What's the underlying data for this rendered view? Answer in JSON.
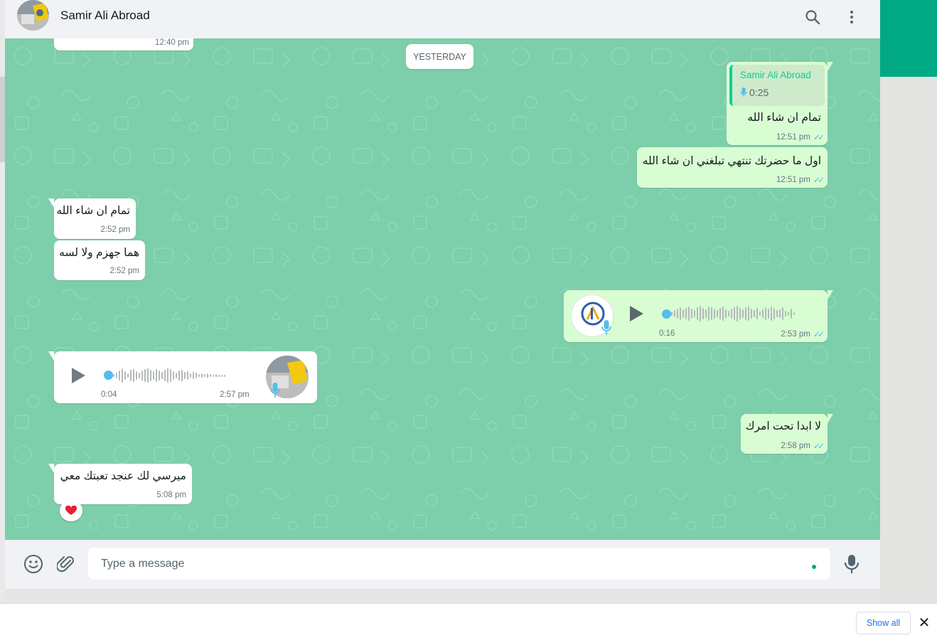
{
  "header": {
    "contact_name": "Samir Ali Abroad"
  },
  "top_partial": {
    "time": "12:40 pm"
  },
  "date_divider": "YESTERDAY",
  "messages": [
    {
      "dir": "out",
      "quote_name": "Samir Ali Abroad",
      "quote_duration": "0:25",
      "text": "تمام ان شاء الله",
      "time": "12:51 pm"
    },
    {
      "dir": "out",
      "text": "اول ما حضرتك تنتهي تبلغني ان شاء الله",
      "time": "12:51 pm"
    },
    {
      "dir": "in",
      "text": "تمام ان شاء الله",
      "time": "2:52 pm"
    },
    {
      "dir": "in",
      "text": "هما جهزم ولا لسه",
      "time": "2:52 pm"
    },
    {
      "dir": "out",
      "voice": true,
      "duration": "0:16",
      "time": "2:53 pm",
      "avatar_text": "RADIANCE GROUP"
    },
    {
      "dir": "in",
      "voice": true,
      "duration": "0:04",
      "time": "2:57 pm"
    },
    {
      "dir": "out",
      "text": "لا ابدا تحت امرك",
      "time": "2:58 pm"
    },
    {
      "dir": "in",
      "text": "ميرسي لك عنجد تعبتك معي",
      "time": "5:08 pm",
      "reaction": "heart"
    }
  ],
  "composer": {
    "placeholder": "Type a message"
  },
  "downloads_bar": {
    "show_all": "Show all",
    "close": "✕"
  },
  "colors": {
    "accent": "#00a884",
    "chat_bg": "#7dceaa",
    "outgoing": "#d9fdd3",
    "read_ticks": "#53bdeb"
  }
}
